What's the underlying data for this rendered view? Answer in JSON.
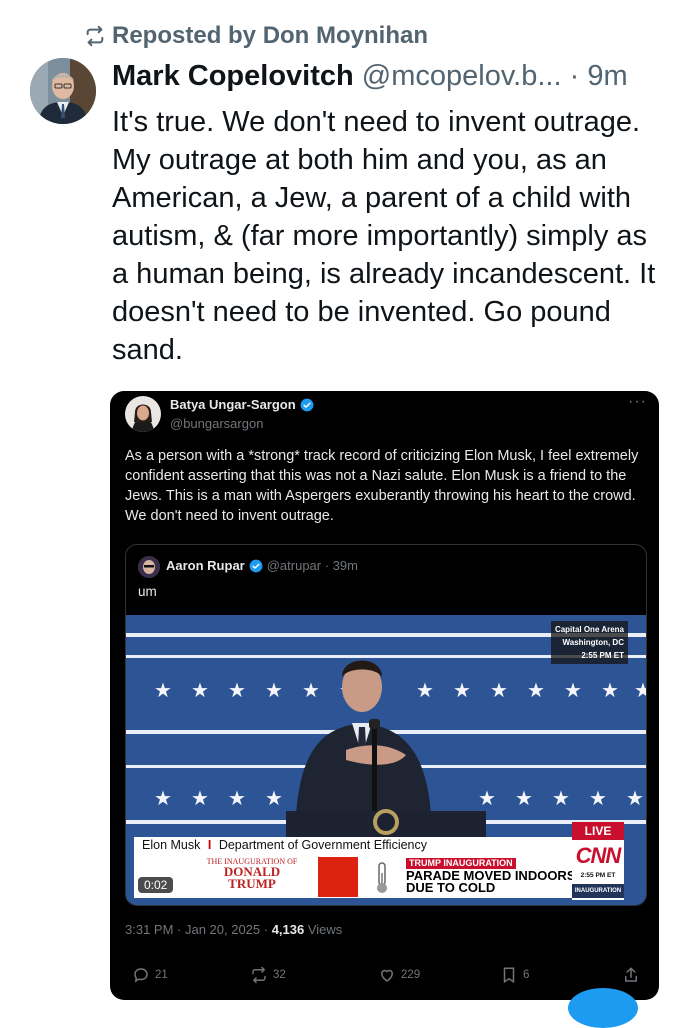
{
  "repost": {
    "icon": "repost-icon",
    "text": "Reposted by Don Moynihan"
  },
  "post": {
    "author_name": "Mark Copelovitch",
    "author_handle": "@mcopelov.b...",
    "time": "· 9m",
    "body": "It's true. We don't need to invent outrage. My outrage at both him and you, as an American, a Jew, a parent of a child with autism, & (far more importantly) simply as a human being, is already incandescent. It doesn't need to be invented. Go pound sand."
  },
  "embed": {
    "author_name": "Batya Ungar-Sargon",
    "author_handle": "@bungarsargon",
    "more": "···",
    "text": "As a person with a *strong* track record of criticizing Elon Musk, I feel extremely confident asserting that this was not a Nazi salute. Elon Musk is a friend to the Jews. This is a man with Aspergers exuberantly throwing his heart to the crowd. We don't need to invent outrage.",
    "quote": {
      "author_name": "Aaron Rupar",
      "author_handle": "@atrupar · 39m",
      "text": "um",
      "video": {
        "location_line1": "Capital One Arena",
        "location_line2": "Washington, DC",
        "location_time": "2:55 PM ET",
        "chyron_name": "Elon Musk",
        "chyron_sep": "I",
        "chyron_title": "Department of Government Efficiency",
        "inaug_small": "THE INAUGURATION OF",
        "inaug_line1": "DONALD",
        "inaug_line2": "TRUMP",
        "news_tag": "TRUMP INAUGURATION",
        "news_line1": "PARADE MOVED INDOORS",
        "news_line2": "DUE TO COLD",
        "live": "LIVE",
        "network": "CNN",
        "network_time": "2:55 PM ET",
        "network_tag": "INAUGURATION",
        "duration": "0:02"
      }
    },
    "meta_time": "3:31 PM · Jan 20, 2025 · ",
    "views_count": "4,136",
    "views_label": " Views",
    "stats": {
      "replies": "21",
      "reposts": "32",
      "likes": "229",
      "bookmarks": "6"
    },
    "colors": {
      "verified": "#1d9bf0",
      "card_bg": "#000000"
    }
  }
}
